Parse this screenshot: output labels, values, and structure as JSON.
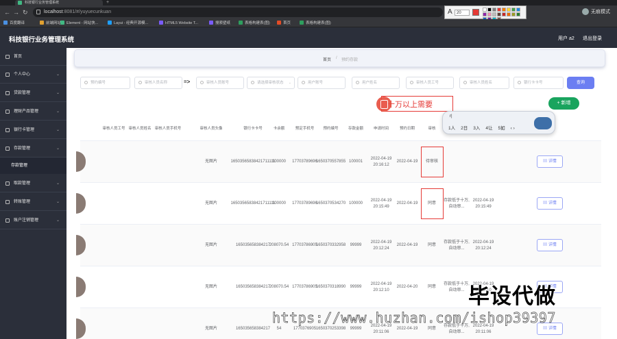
{
  "browser": {
    "tab_title": "科技银行业务管理系统",
    "url_host": "localhost",
    "url_path": ":8081/#/yuyuecunkuan",
    "profile_label": "无痕模式",
    "bookmarks": [
      "百度翻译",
      "前端网站",
      "Element - 网站快...",
      "Layui - 经典开源模...",
      "HTML5 Website T...",
      "搜索壁纸",
      "表格构建表(图)",
      "首页",
      "表格构建表(图)"
    ]
  },
  "annotation_toolbar": {
    "font_size": "20",
    "current_color": "#e53935",
    "swatches": [
      "#ffffff",
      "#000000",
      "#7f7f7f",
      "#e53935",
      "#f57c00",
      "#fdd835",
      "#43a047",
      "#1e88e5",
      "#8e24aa",
      "#f48fb1",
      "#bdbdbd",
      "#5d4037",
      "#c62828",
      "#ef6c00",
      "#9e9d24",
      "#2e7d32",
      "#1565c0",
      "#6a1b9a",
      "#00acc1",
      "#795548"
    ]
  },
  "header": {
    "title": "科技银行业务管理系统",
    "user": "用户 a2",
    "logout": "退出登录"
  },
  "sidebar": {
    "items": [
      {
        "label": "首页",
        "chevron": false
      },
      {
        "label": "个人中心",
        "chevron": true
      },
      {
        "label": "贷款管理",
        "chevron": true
      },
      {
        "label": "理财产品管理",
        "chevron": true
      },
      {
        "label": "银行卡管理",
        "chevron": true
      },
      {
        "label": "存款管理",
        "chevron": true
      },
      {
        "label": "取款管理",
        "chevron": true
      },
      {
        "label": "转账管理",
        "chevron": true
      },
      {
        "label": "账户注销管理",
        "chevron": true
      }
    ],
    "subitem": "存款管理"
  },
  "breadcrumb": {
    "home": "首页",
    "separator": "/",
    "current": "预约存款"
  },
  "search": {
    "fields": [
      "预约编号",
      "审核人员名称",
      "审核人员账号",
      "请选择审核状态",
      "用户账号",
      "用户姓名",
      "审核人员工号",
      "审核人员姓名",
      "银行卡卡号"
    ],
    "arrow_text": "=>",
    "button": "查询",
    "add_button": "+ 新增"
  },
  "annotation": {
    "text": "十万以上需要"
  },
  "ime": {
    "composition": "r|",
    "candidates": [
      "1人",
      "2日",
      "3入",
      "4让",
      "5如"
    ],
    "more": "‹ ›"
  },
  "table": {
    "columns": [
      "审核人员工号",
      "审核人员姓名",
      "审核人员手机号",
      "审核人员头像",
      "银行卡卡号",
      "卡余额",
      "预定手机号",
      "预约编号",
      "存款金额",
      "申请时间",
      "预约日期",
      "审核",
      "审核意见",
      "审核时间",
      "操作"
    ],
    "rows": [
      {
        "avatar_text": "无图片",
        "card_no": "16503565838421711111",
        "balance": "100000",
        "phone": "17703789696",
        "booking_no": "1650370557855",
        "amount": "100001",
        "apply_time": "2022-04-19 20:16:12",
        "booking_date": "2022-04-19",
        "status": "待审核",
        "opinion": "",
        "audit_time": "",
        "action": "详情"
      },
      {
        "avatar_text": "无图片",
        "card_no": "16503565838421711111",
        "balance": "100000",
        "phone": "17703789696",
        "booking_no": "1650370534270",
        "amount": "100000",
        "apply_time": "2022-04-19 20:15:49",
        "booking_date": "2022-04-19",
        "status": "同意",
        "opinion": "存款低于十万,自动审...",
        "audit_time": "2022-04-19 20:15:49",
        "action": "详情"
      },
      {
        "avatar_text": "无图片",
        "card_no": "165035658384217",
        "balance": "208070.54",
        "phone": "17703786905",
        "booking_no": "1650370332958",
        "amount": "99999",
        "apply_time": "2022-04-19 20:12:24",
        "booking_date": "2022-04-19",
        "status": "同意",
        "opinion": "存款低于十万,自动审...",
        "audit_time": "2022-04-19 20:12:24",
        "action": "详情"
      },
      {
        "avatar_text": "无图片",
        "card_no": "165035658384217",
        "balance": "208070.54",
        "phone": "17703786905",
        "booking_no": "1650370318990",
        "amount": "99999",
        "apply_time": "2022-04-19 20:12:10",
        "booking_date": "2022-04-20",
        "status": "同意",
        "opinion": "存款低于十万,自动审...",
        "audit_time": "2022-04-19 20:12:10",
        "action": "详情"
      },
      {
        "avatar_text": "无图片",
        "card_no": "165035658384217",
        "balance": "54",
        "phone": "1770376905",
        "booking_no": "1650370253398",
        "amount": "99999",
        "apply_time": "2022-04-19 20:11:06",
        "booking_date": "2022-04-19",
        "status": "同意",
        "opinion": "存款低于十万,自动审...",
        "audit_time": "2022-04-19 20:11:06",
        "action": "详情"
      }
    ]
  },
  "watermark": {
    "big": "毕设代做",
    "url": "https://www.huzhan.com/ishop39397"
  }
}
